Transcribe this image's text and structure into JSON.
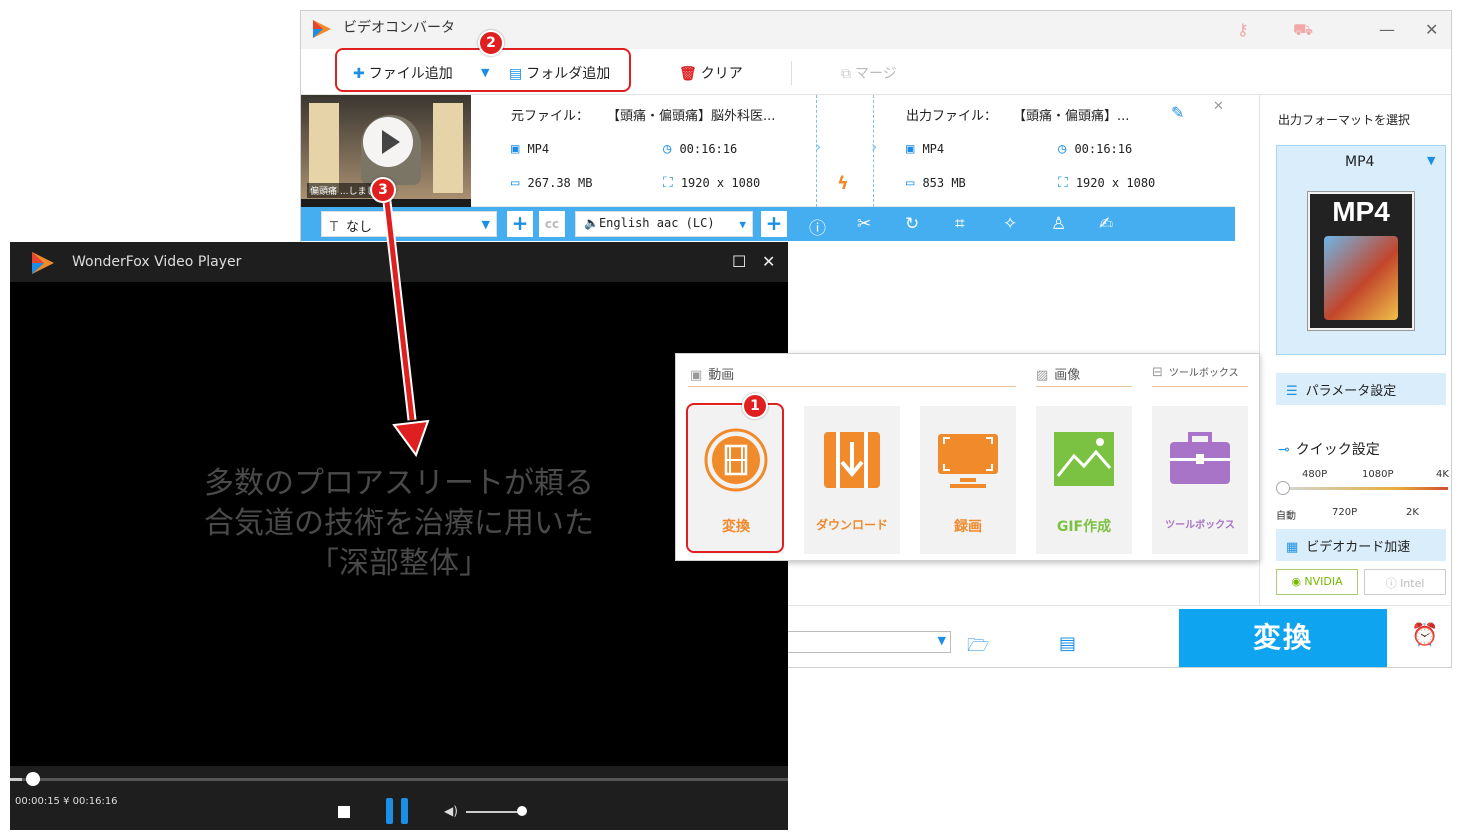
{
  "converter": {
    "title": "ビデオコンバータ",
    "toolbar": {
      "add_file": "ファイル追加",
      "add_folder": "フォルダ追加",
      "clear": "クリア",
      "merge": "マージ"
    },
    "file": {
      "source_label": "元ファイル：",
      "source_name": "【頭痛・偏頭痛】脳外科医...",
      "output_label": "出力ファイル：",
      "output_name": "【頭痛・偏頭痛】...",
      "source_format": "MP4",
      "source_duration": "00:16:16",
      "source_size": "267.38 MB",
      "source_resolution": "1920 x 1080",
      "output_format": "MP4",
      "output_duration": "00:16:16",
      "output_size": "853 MB",
      "output_resolution": "1920 x 1080",
      "thumb_caption": "偏頭痛 ...しまして"
    },
    "bluebar": {
      "subtitle_value": "なし",
      "audio_value": "English aac (LC)"
    },
    "right_panel": {
      "title": "出力フォーマットを選択",
      "format": "MP4",
      "format_box_text": "MP4",
      "param_button": "パラメータ設定",
      "quick_label": "クイック設定",
      "quick_top": [
        "480P",
        "1080P",
        "4K"
      ],
      "quick_bottom": [
        "自動",
        "720P",
        "2K"
      ],
      "gpu_button": "ビデオカード加速",
      "nvidia": "NVIDIA",
      "intel": "Intel"
    },
    "convert_button": "変換"
  },
  "player": {
    "title": "WonderFox Video Player",
    "subtitle_lines": [
      "多数のプロアスリートが頼る",
      "合気道の技術を治療に用いた",
      "「深部整体」"
    ],
    "time": "00:00:15 ¥ 00:16:16",
    "progress": 0.015,
    "volume": 1.0
  },
  "popup": {
    "section_video": "動画",
    "section_image": "画像",
    "section_toolbox": "ツールボックス",
    "tiles": [
      "変換",
      "ダウンロード",
      "録画",
      "GIF作成",
      "ツールボックス"
    ]
  },
  "annotations": {
    "badge_1": "1",
    "badge_2": "2",
    "badge_3": "3"
  },
  "colors": {
    "accent_blue": "#0fa4ef",
    "orange": "#f08a2b",
    "green": "#7cc242",
    "purple": "#a874c8",
    "annotation_red": "#e02020"
  }
}
